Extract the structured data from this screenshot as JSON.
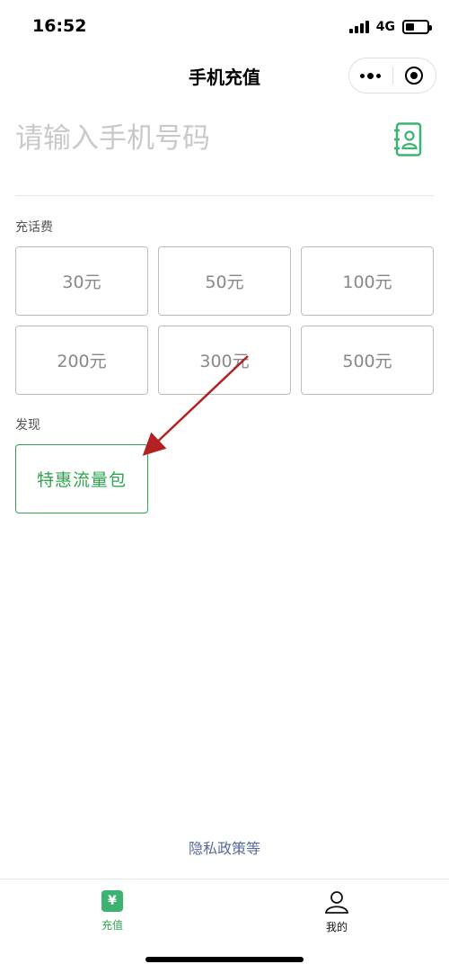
{
  "status": {
    "time": "16:52",
    "network": "4G"
  },
  "nav": {
    "title": "手机充值"
  },
  "phone": {
    "placeholder": "请输入手机号码"
  },
  "recharge": {
    "label": "充话费",
    "amounts": [
      "30元",
      "50元",
      "100元",
      "200元",
      "300元",
      "500元"
    ]
  },
  "discover": {
    "label": "发现",
    "card": "特惠流量包"
  },
  "footer": {
    "privacy": "隐私政策等"
  },
  "tabs": [
    {
      "label": "充值",
      "icon": "yen-icon",
      "active": true
    },
    {
      "label": "我的",
      "icon": "user-icon",
      "active": false
    }
  ],
  "colors": {
    "accent": "#2ea44f",
    "link": "#576b95",
    "annotation_arrow": "#b22222"
  }
}
